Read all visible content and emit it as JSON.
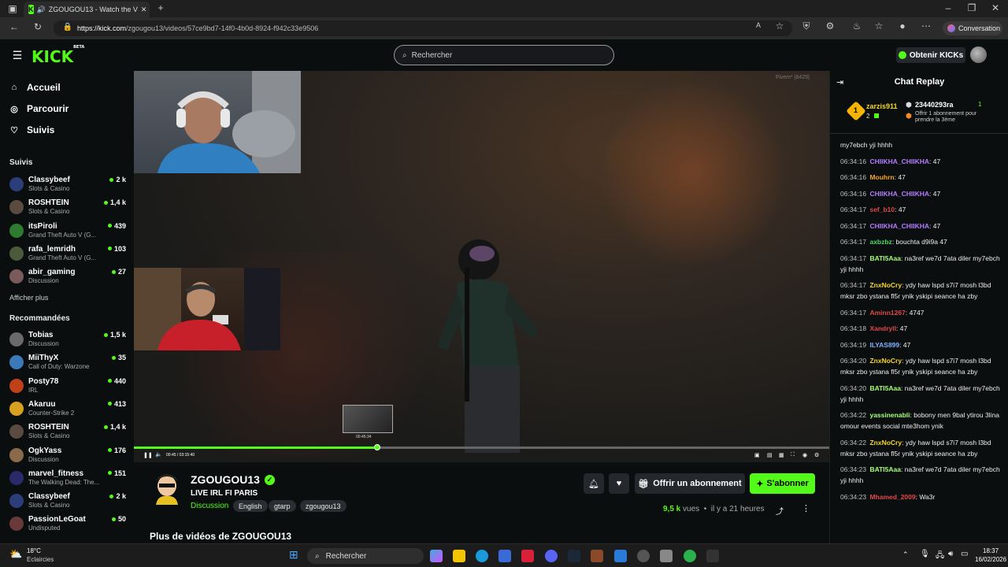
{
  "browser": {
    "tab_title": "ZGOUGOU13 - Watch the V",
    "url_host": "https://kick.com",
    "url_path": "/zgougou13/videos/57ce9bd7-14f0-4b0d-8924-f942c33e9506",
    "conversation_label": "Conversation"
  },
  "header": {
    "logo": "KICK",
    "logo_badge": "BETA",
    "search_placeholder": "Rechercher",
    "kicks_button": "Obtenir KICKs"
  },
  "sidebar": {
    "nav": [
      {
        "label": "Accueil",
        "icon": "home-icon"
      },
      {
        "label": "Parcourir",
        "icon": "compass-icon"
      },
      {
        "label": "Suivis",
        "icon": "heart-icon"
      }
    ],
    "followed_title": "Suivis",
    "followed": [
      {
        "name": "Classybeef",
        "category": "Slots & Casino",
        "viewers": "2 k",
        "color": "#2c3e7a"
      },
      {
        "name": "ROSHTEIN",
        "category": "Slots & Casino",
        "viewers": "1,4 k",
        "color": "#5a4a3f"
      },
      {
        "name": "itsPiroli",
        "category": "Grand Theft Auto V (G...",
        "viewers": "439",
        "color": "#2e7a2e"
      },
      {
        "name": "rafa_lemridh",
        "category": "Grand Theft Auto V (G...",
        "viewers": "103",
        "color": "#4a5a3a"
      },
      {
        "name": "abir_gaming",
        "category": "Discussion",
        "viewers": "27",
        "color": "#7a5a5a"
      }
    ],
    "show_more": "Afficher plus",
    "recommended_title": "Recommandées",
    "recommended": [
      {
        "name": "Tobias",
        "category": "Discussion",
        "viewers": "1,5 k",
        "color": "#6a6a6a"
      },
      {
        "name": "MiiThyX",
        "category": "Call of Duty: Warzone",
        "viewers": "35",
        "color": "#3a7ab8"
      },
      {
        "name": "Posty78",
        "category": "IRL",
        "viewers": "440",
        "color": "#c0401a"
      },
      {
        "name": "Akaruu",
        "category": "Counter-Strike 2",
        "viewers": "413",
        "color": "#d8a020"
      },
      {
        "name": "ROSHTEIN",
        "category": "Slots & Casino",
        "viewers": "1,4 k",
        "color": "#5a4a3f"
      },
      {
        "name": "OgkYass",
        "category": "Discussion",
        "viewers": "176",
        "color": "#8a6a4a"
      },
      {
        "name": "marvel_fitness",
        "category": "The Walking Dead: The...",
        "viewers": "151",
        "color": "#2a2a6a"
      },
      {
        "name": "Classybeef",
        "category": "Slots & Casino",
        "viewers": "2 k",
        "color": "#2c3e7a"
      },
      {
        "name": "PassionLeGoat",
        "category": "Undisputed",
        "viewers": "50",
        "color": "#6a3a3a"
      }
    ]
  },
  "video": {
    "watermark": "Fivem* |8425|",
    "preview_time": "00:45:34",
    "time_display": "00:45 / 03:15:40",
    "progress": 0.35
  },
  "channel": {
    "name": "ZGOUGOU13",
    "title": "LIVE IRL FI PARIS",
    "category": "Discussion",
    "tags": [
      "English",
      "gtarp",
      "zgougou13"
    ],
    "gift_button": "Offrir un abonnement",
    "subscribe_button": "S'abonner",
    "views_count": "9,5 k",
    "views_label": "vues",
    "time_ago": "il y a 21 heures",
    "more_videos": "Plus de vidéos de ZGOUGOU13"
  },
  "chat": {
    "title": "Chat Replay",
    "pinned": {
      "rank": "1",
      "user1": "zarzis911",
      "user1_count": "2",
      "user2": "23440293ra",
      "user2_count": "1",
      "gift_text": "Offrir 1 abonnement pour prendre la 3ème"
    },
    "messages": [
      {
        "time": "",
        "user": "",
        "color": "#eee",
        "text": "my7ebch yji hhhh"
      },
      {
        "time": "06:34:16",
        "user": "CHIIKHA_CHIIKHA",
        "color": "#b57cff",
        "text": "47"
      },
      {
        "time": "06:34:16",
        "user": "Mouhrn",
        "color": "#f5a623",
        "text": "47"
      },
      {
        "time": "06:34:16",
        "user": "CHIIKHA_CHIIKHA",
        "color": "#b57cff",
        "text": "47"
      },
      {
        "time": "06:34:17",
        "user": "sef_b10",
        "color": "#e04848",
        "text": "47"
      },
      {
        "time": "06:34:17",
        "user": "CHIIKHA_CHIIKHA",
        "color": "#b57cff",
        "text": "47"
      },
      {
        "time": "06:34:17",
        "user": "axbzbz",
        "color": "#4cd964",
        "text": "bouchta d9i9a 47"
      },
      {
        "time": "06:34:17",
        "user": "BATI5Aaa",
        "color": "#a6ff7a",
        "text": "na3ref we7d 7ata diler my7ebch yji hhhh"
      },
      {
        "time": "06:34:17",
        "user": "ZnxNoCry",
        "color": "#f5d623",
        "text": "ydy haw lspd s7i7 mosh l3bd mksr zbo ystana fl5r ynik yskipi seance ha zby"
      },
      {
        "time": "06:34:17",
        "user": "Aminn1267",
        "color": "#e04848",
        "text": "4747"
      },
      {
        "time": "06:34:18",
        "user": "Xandryll",
        "color": "#e04848",
        "text": "47"
      },
      {
        "time": "06:34:19",
        "user": "ILYAS899",
        "color": "#7fb2ff",
        "text": "47"
      },
      {
        "time": "06:34:20",
        "user": "ZnxNoCry",
        "color": "#f5d623",
        "text": "ydy haw lspd s7i7 mosh l3bd mksr zbo ystana fl5r ynik yskipi seance ha zby"
      },
      {
        "time": "06:34:20",
        "user": "BATI5Aaa",
        "color": "#a6ff7a",
        "text": "na3ref we7d 7ata diler my7ebch yji hhhh"
      },
      {
        "time": "06:34:22",
        "user": "yassinenabli",
        "color": "#a6ff7a",
        "text": "bobony men 9bal ytirou 3lina omour events social mte3hom ynik"
      },
      {
        "time": "06:34:22",
        "user": "ZnxNoCry",
        "color": "#f5d623",
        "text": "ydy haw lspd s7i7 mosh l3bd mksr zbo ystana fl5r ynik yskipi seance ha zby"
      },
      {
        "time": "06:34:23",
        "user": "BATI5Aaa",
        "color": "#a6ff7a",
        "text": "na3ref we7d 7ata diler my7ebch yji hhhh"
      },
      {
        "time": "06:34:23",
        "user": "Mhamed_2009",
        "color": "#e04848",
        "text": "Wa3r"
      }
    ]
  },
  "taskbar": {
    "weather_temp": "18°C",
    "weather_desc": "Eclaircies",
    "search": "Rechercher",
    "time": "18:37",
    "date": "16/02/2026"
  },
  "colors": {
    "accent": "#53fc18",
    "bg": "#0b0e0f"
  }
}
